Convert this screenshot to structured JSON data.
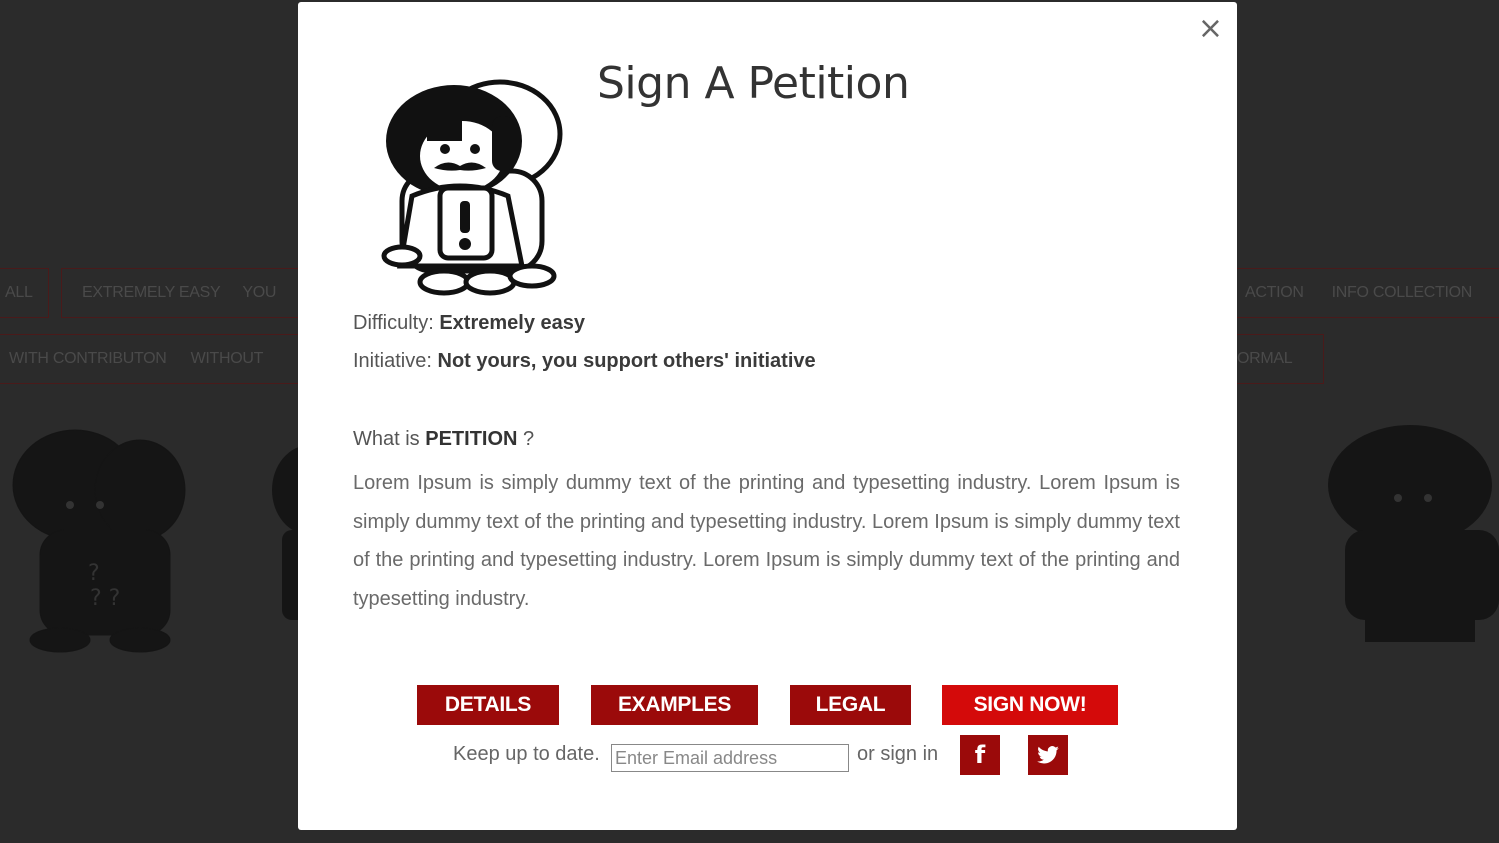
{
  "background": {
    "filter_row1": [
      "ALL",
      "EXTREMELY EASY",
      "YOU",
      "ACTION",
      "INFO COLLECTION"
    ],
    "filter_row2": [
      "WITH CONTRIBUTON",
      "WITHOUT",
      "ORMAL"
    ]
  },
  "modal": {
    "close_symbol": "×",
    "title": "Sign A Petition",
    "difficulty_label": "Difficulty:",
    "difficulty_value": "Extremely easy",
    "initiative_label": "Initiative:",
    "initiative_value": "Not yours, you support others' initiative",
    "what_is_prefix": "What is",
    "what_is_term": "PETITION",
    "what_is_suffix": "?",
    "description": "Lorem Ipsum is simply dummy text of the printing and typesetting industry. Lorem Ipsum is simply dummy text of the printing and typesetting industry. Lorem Ipsum is simply dummy text of the printing and typesetting industry. Lorem Ipsum is simply dummy text of the printing and typesetting industry.",
    "buttons": {
      "details": "DETAILS",
      "examples": "EXAMPLES",
      "legal": "LEGAL",
      "sign_now": "SIGN NOW!"
    },
    "signup": {
      "label": "Keep up to date.",
      "email_placeholder": "Enter Email address",
      "or_sign_in": "or sign in",
      "facebook_icon": "f"
    }
  },
  "colors": {
    "dark_red": "#9b0a0a",
    "bright_red": "#d40a0a",
    "overlay": "#2b2b2b"
  }
}
